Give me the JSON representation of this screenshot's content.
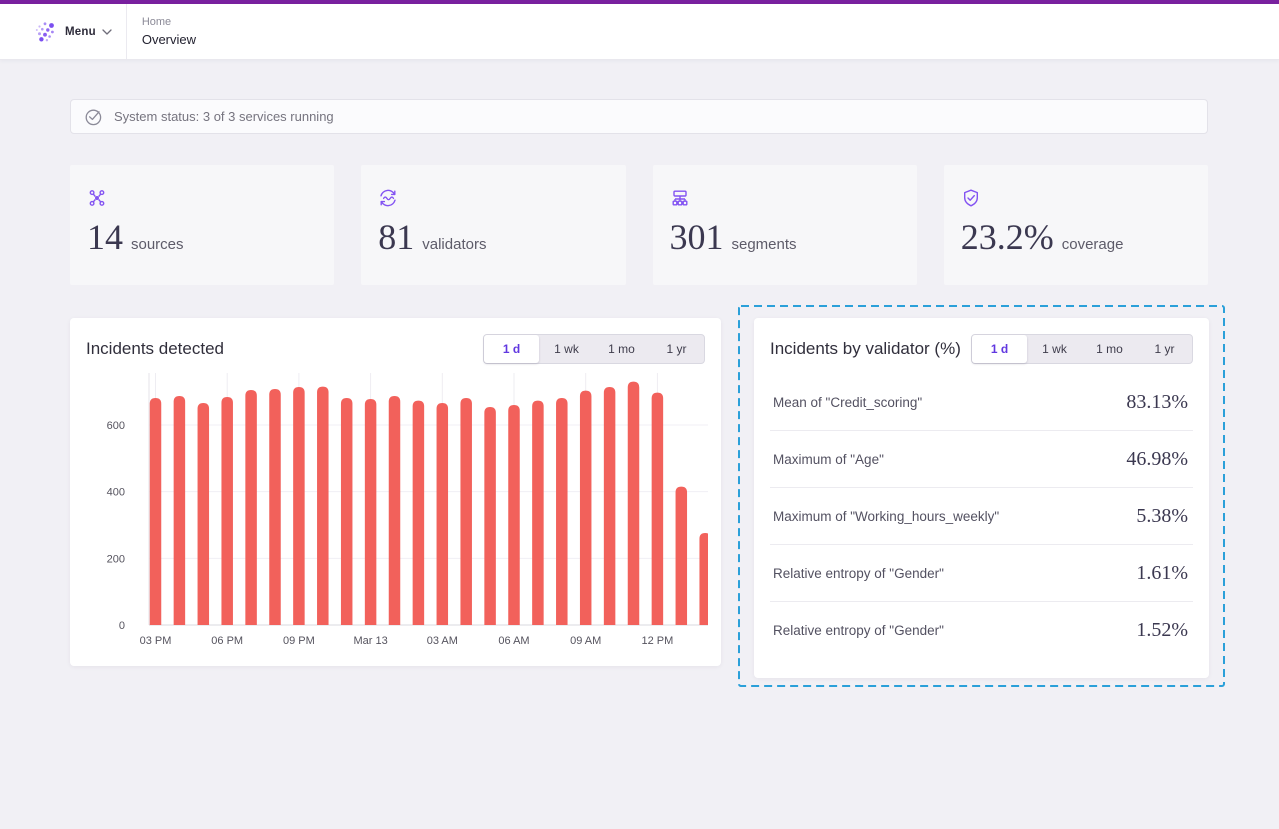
{
  "topbar": {
    "accent_color": "#79219f"
  },
  "header": {
    "menu_label": "Menu",
    "breadcrumb": {
      "section": "Home",
      "page": "Overview"
    }
  },
  "status_banner": {
    "text": "System status: 3 of 3 services running"
  },
  "stats": [
    {
      "icon": "hub-icon",
      "value": "14",
      "label": "sources"
    },
    {
      "icon": "sync-pulse-icon",
      "value": "81",
      "label": "validators"
    },
    {
      "icon": "sitemap-icon",
      "value": "301",
      "label": "segments"
    },
    {
      "icon": "shield-check-icon",
      "value": "23.2%",
      "label": "coverage"
    }
  ],
  "time_tabs": [
    "1 d",
    "1 wk",
    "1 mo",
    "1 yr"
  ],
  "incidents_panel": {
    "title": "Incidents detected",
    "selected_tab": "1 d"
  },
  "chart_data": {
    "type": "bar",
    "title": "Incidents detected",
    "values": [
      681,
      687,
      666,
      684,
      705,
      708,
      714,
      715,
      681,
      678,
      687,
      673,
      666,
      681,
      654,
      660,
      673,
      681,
      703,
      714,
      730,
      697,
      415,
      276
    ],
    "x_tick_labels": [
      "03 PM",
      "06 PM",
      "09 PM",
      "Mar 13",
      "03 AM",
      "06 AM",
      "09 AM",
      "12 PM"
    ],
    "x_tick_every": 3,
    "ylabel": "",
    "yticks": [
      0,
      200,
      400,
      600
    ],
    "ylim": [
      0,
      750
    ],
    "bar_color": "#f2615b",
    "legend": "none",
    "grid": true
  },
  "validator_panel": {
    "title": "Incidents by validator (%)",
    "selected_tab": "1 d",
    "rows": [
      {
        "label": "Mean of \"Credit_scoring\"",
        "value": "83.13%"
      },
      {
        "label": "Maximum of \"Age\"",
        "value": "46.98%"
      },
      {
        "label": "Maximum of \"Working_hours_weekly\"",
        "value": "5.38%"
      },
      {
        "label": "Relative entropy of \"Gender\"",
        "value": "1.61%"
      },
      {
        "label": "Relative entropy of \"Gender\"",
        "value": "1.52%"
      }
    ]
  },
  "colors": {
    "accent_purple": "#8353f2",
    "bar_red": "#f2615b",
    "selection_dashed": "#2ba0d9",
    "selected_tab_text": "#6138e0"
  }
}
